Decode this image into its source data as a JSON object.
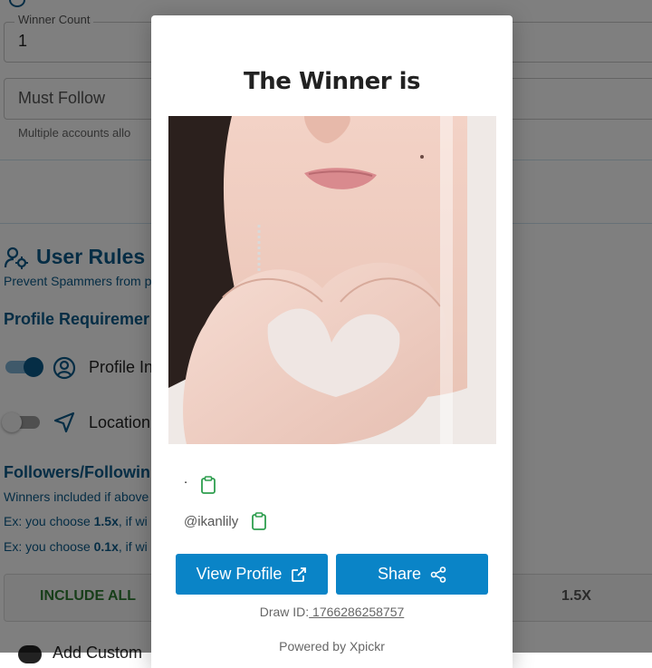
{
  "background": {
    "winner_count_label": "Winner Count",
    "winner_count_value": "1",
    "must_follow_placeholder": "Must Follow",
    "must_follow_hint": "Multiple accounts allo",
    "user_rules_title": "User Rules",
    "user_rules_extra": "(",
    "user_rules_subtitle": "Prevent Spammers from p",
    "profile_requirements": "Profile Requiremer",
    "profile_item_label": "Profile In",
    "location_label": "Location",
    "followers_title": "Followers/Followin",
    "followers_hint": "Winners included if above",
    "example1_prefix": "Ex: you choose ",
    "example1_value": "1.5x",
    "example1_suffix": ", if wi",
    "example2_prefix": "Ex: you choose ",
    "example2_value": "0.1x",
    "example2_suffix": ", if wi",
    "include_all": "INCLUDE ALL",
    "ratio_option": "1.5X",
    "add_custom": "Add Custom"
  },
  "modal": {
    "title": "The Winner is",
    "winner_name": ".",
    "winner_handle": "@ikanlily",
    "view_profile_label": "View Profile",
    "share_label": "Share",
    "draw_id_label": "Draw ID:",
    "draw_id_value": " 1766286258757",
    "powered_by": "Powered by Xpickr"
  },
  "colors": {
    "accent": "#0a84c7",
    "heading_blue": "#0a5a8a",
    "clipboard_green": "#2e9e4f",
    "include_all_green": "#2e7d32"
  },
  "icons": {
    "clipboard": "clipboard-icon",
    "external_link": "external-link-icon",
    "share": "share-icon",
    "user_gear": "user-gear-icon",
    "user_circle": "user-circle-icon",
    "location": "navigation-arrow-icon"
  }
}
